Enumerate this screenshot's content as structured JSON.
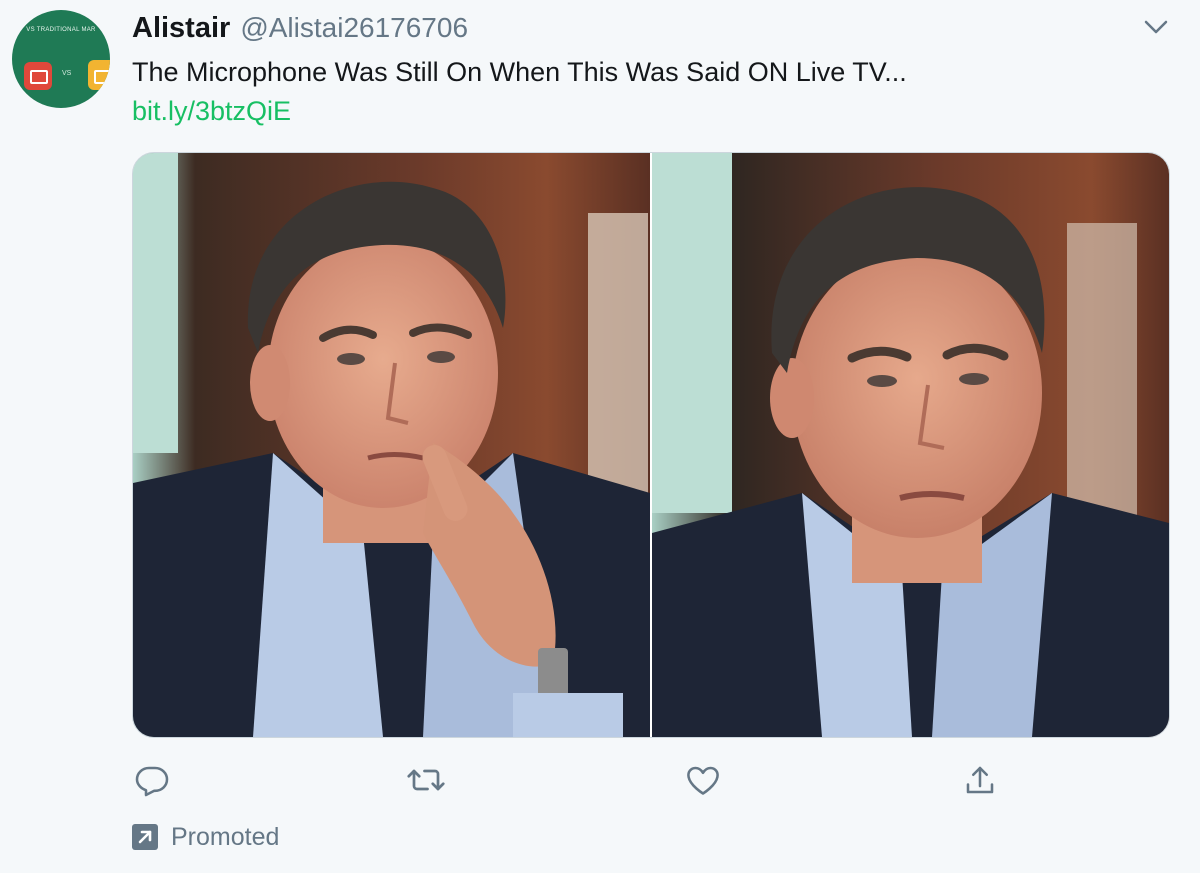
{
  "tweet": {
    "author_name": "Alistair",
    "handle": "@Alistai26176706",
    "text": "The Microphone Was Still On When This Was Said ON Live TV...",
    "link_text": "bit.ly/3btzQiE",
    "promoted_label": "Promoted"
  },
  "avatar": {
    "banner_text": "VS TRADITIONAL MAR",
    "vs_text": "VS",
    "bg_color": "#1f7a55"
  },
  "media": {
    "images": [
      {
        "description_name": "man-touching-lip-photo"
      },
      {
        "description_name": "man-frowning-photo"
      }
    ]
  },
  "icons": {
    "menu": "chevron-down-icon",
    "reply": "reply-icon",
    "retweet": "retweet-icon",
    "like": "heart-icon",
    "share": "share-icon",
    "promoted": "promoted-arrow-icon"
  },
  "colors": {
    "link": "#17bf63",
    "secondary_text": "#657786",
    "background": "#f5f8fa"
  }
}
